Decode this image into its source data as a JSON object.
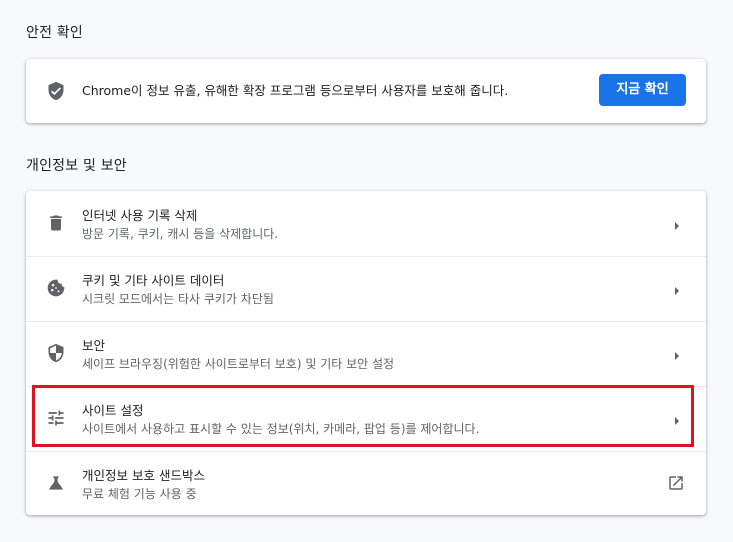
{
  "safety_check": {
    "title": "안전 확인",
    "description": "Chrome이 정보 유출, 유해한 확장 프로그램 등으로부터 사용자를 보호해 줍니다.",
    "button_label": "지금 확인",
    "icon": "shield-check-icon"
  },
  "privacy": {
    "title": "개인정보 및 보안",
    "items": [
      {
        "title": "인터넷 사용 기록 삭제",
        "subtitle": "방문 기록, 쿠키, 캐시 등을 삭제합니다.",
        "icon": "trash-icon",
        "action": "arrow"
      },
      {
        "title": "쿠키 및 기타 사이트 데이터",
        "subtitle": "시크릿 모드에서는 타사 쿠키가 차단됨",
        "icon": "cookie-icon",
        "action": "arrow"
      },
      {
        "title": "보안",
        "subtitle": "세이프 브라우징(위험한 사이트로부터 보호) 및 기타 보안 설정",
        "icon": "shield-icon",
        "action": "arrow"
      },
      {
        "title": "사이트 설정",
        "subtitle": "사이트에서 사용하고 표시할 수 있는 정보(위치, 카메라, 팝업 등)를 제어합니다.",
        "icon": "tune-icon",
        "action": "arrow"
      },
      {
        "title": "개인정보 보호 샌드박스",
        "subtitle": "무료 체험 기능 사용 중",
        "icon": "flask-icon",
        "action": "external-link"
      }
    ]
  },
  "colors": {
    "accent": "#1a73e8",
    "highlight": "#e0121f"
  }
}
